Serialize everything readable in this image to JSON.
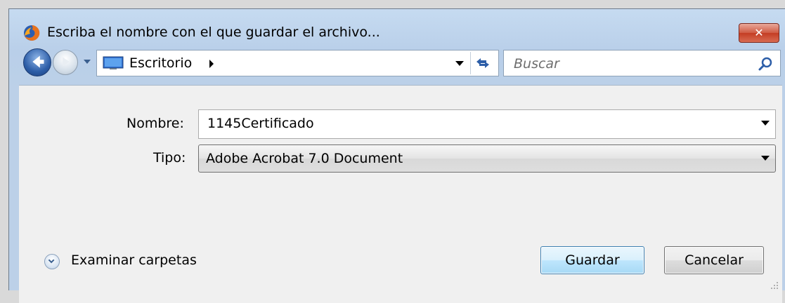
{
  "window": {
    "title": "Escriba el nombre con el que guardar el archivo...",
    "close_icon": "close-icon"
  },
  "nav": {
    "location": "Escritorio",
    "search_placeholder": "Buscar"
  },
  "form": {
    "name_label": "Nombre:",
    "name_value": "1145Certificado",
    "type_label": "Tipo:",
    "type_value": "Adobe Acrobat 7.0 Document"
  },
  "footer": {
    "browse_label": "Examinar carpetas",
    "save_label": "Guardar",
    "cancel_label": "Cancelar"
  },
  "colors": {
    "close_button": "#c43d24",
    "save_button_border": "#3c7fb1",
    "frame": "#bcd0e8"
  }
}
